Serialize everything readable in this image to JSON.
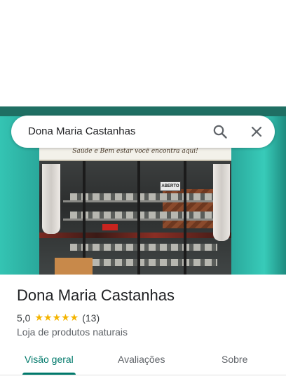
{
  "search": {
    "query": "Dona Maria Castanhas",
    "search_icon": "search-icon",
    "close_icon": "close-icon"
  },
  "photo": {
    "sign_text": "Saúde e Bem estar você encontra aqui!",
    "open_sign": "ABERTO"
  },
  "place": {
    "name": "Dona Maria Castanhas",
    "rating": "5,0",
    "stars": "★★★★★",
    "review_count": "(13)",
    "category": "Loja de produtos naturais"
  },
  "tabs": [
    {
      "label": "Visão geral",
      "active": true
    },
    {
      "label": "Avaliações",
      "active": false
    },
    {
      "label": "Sobre",
      "active": false
    }
  ],
  "colors": {
    "accent": "#00796b",
    "star": "#f4b400",
    "text_primary": "#202124",
    "text_secondary": "#5f6368"
  }
}
